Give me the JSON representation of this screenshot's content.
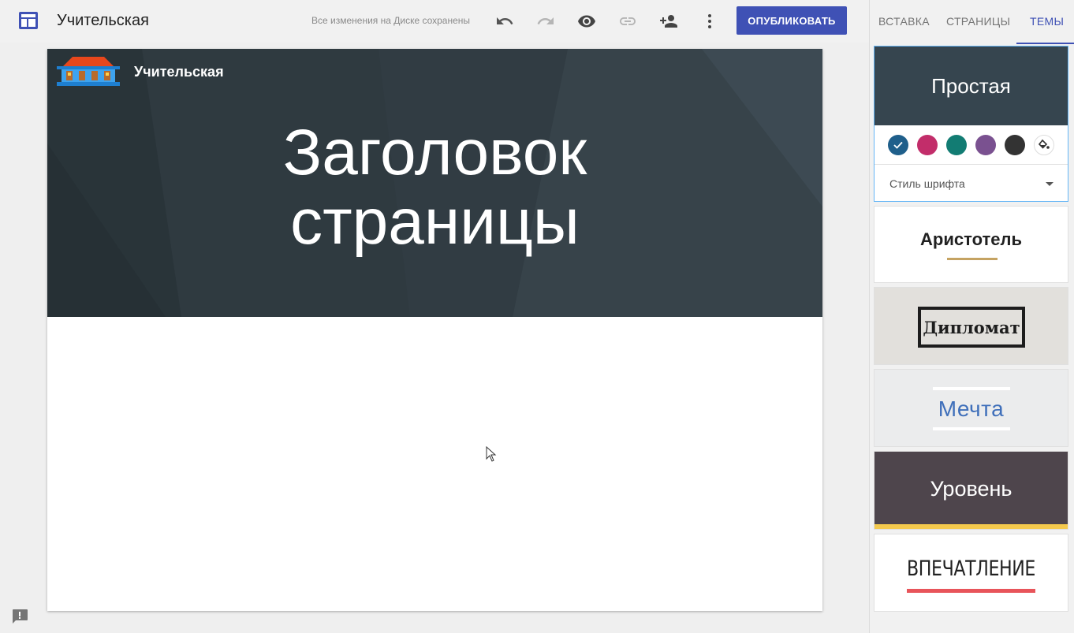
{
  "app": {
    "title": "Учительская",
    "save_status": "Все изменения на Диске сохранены",
    "publish_label": "ОПУБЛИКОВАТЬ",
    "toolbar_icons": [
      "undo-icon",
      "redo-icon",
      "preview-icon",
      "link-icon",
      "share-icon",
      "more-icon"
    ]
  },
  "canvas": {
    "site_name": "Учительская",
    "page_title_line1": "Заголовок",
    "page_title_line2": "страницы"
  },
  "sidebar": {
    "tabs": [
      {
        "label": "ВСТАВКА",
        "active": false
      },
      {
        "label": "СТРАНИЦЫ",
        "active": false
      },
      {
        "label": "ТЕМЫ",
        "active": true
      }
    ],
    "themes": {
      "simple": {
        "label": "Простая",
        "font_style_label": "Стиль шрифта",
        "swatches": [
          "#1f5f8b",
          "#c22d6a",
          "#127c73",
          "#7a5190",
          "#333333"
        ],
        "selected_swatch": 0
      },
      "aristotel": "Аристотель",
      "diplomat": "Дипломат",
      "mechta": "Мечта",
      "uroven": "Уровень",
      "vpechatlenie": "ВПЕЧАТЛЕНИЕ"
    }
  },
  "colors": {
    "accent": "#3f51b5",
    "hero_bg": "#2f3a40"
  }
}
